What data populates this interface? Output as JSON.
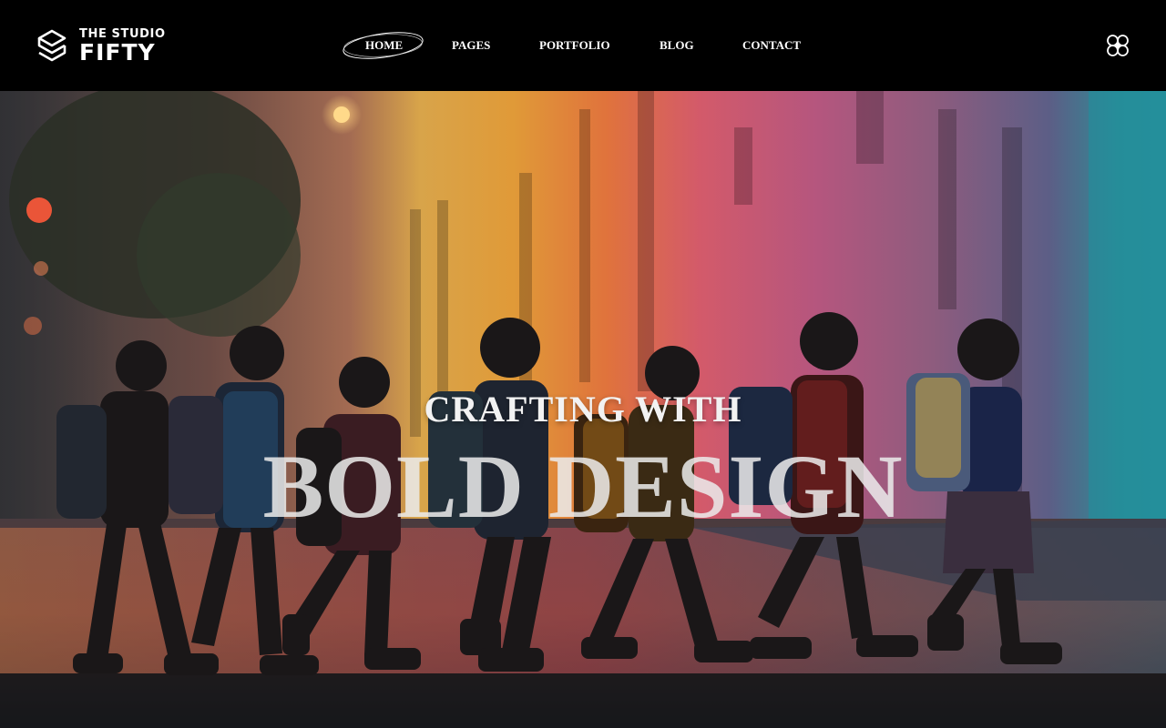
{
  "brand": {
    "top": "THE STUDIO",
    "bottom": "FIFTY"
  },
  "nav": {
    "home": "HOME",
    "pages": "PAGES",
    "portfolio": "PORTFOLIO",
    "blog": "BLOG",
    "contact": "CONTACT",
    "active": "HOME"
  },
  "header_icons": {
    "menu": "flower-menu-icon",
    "logo": "stacked-s-logo-icon"
  },
  "hero": {
    "line1": "CRAFTING WITH",
    "line2": "BOLD DESIGN",
    "photo": "children-crossing-colorful-street"
  },
  "colors": {
    "header_bg": "#000000",
    "text": "#ffffff"
  }
}
